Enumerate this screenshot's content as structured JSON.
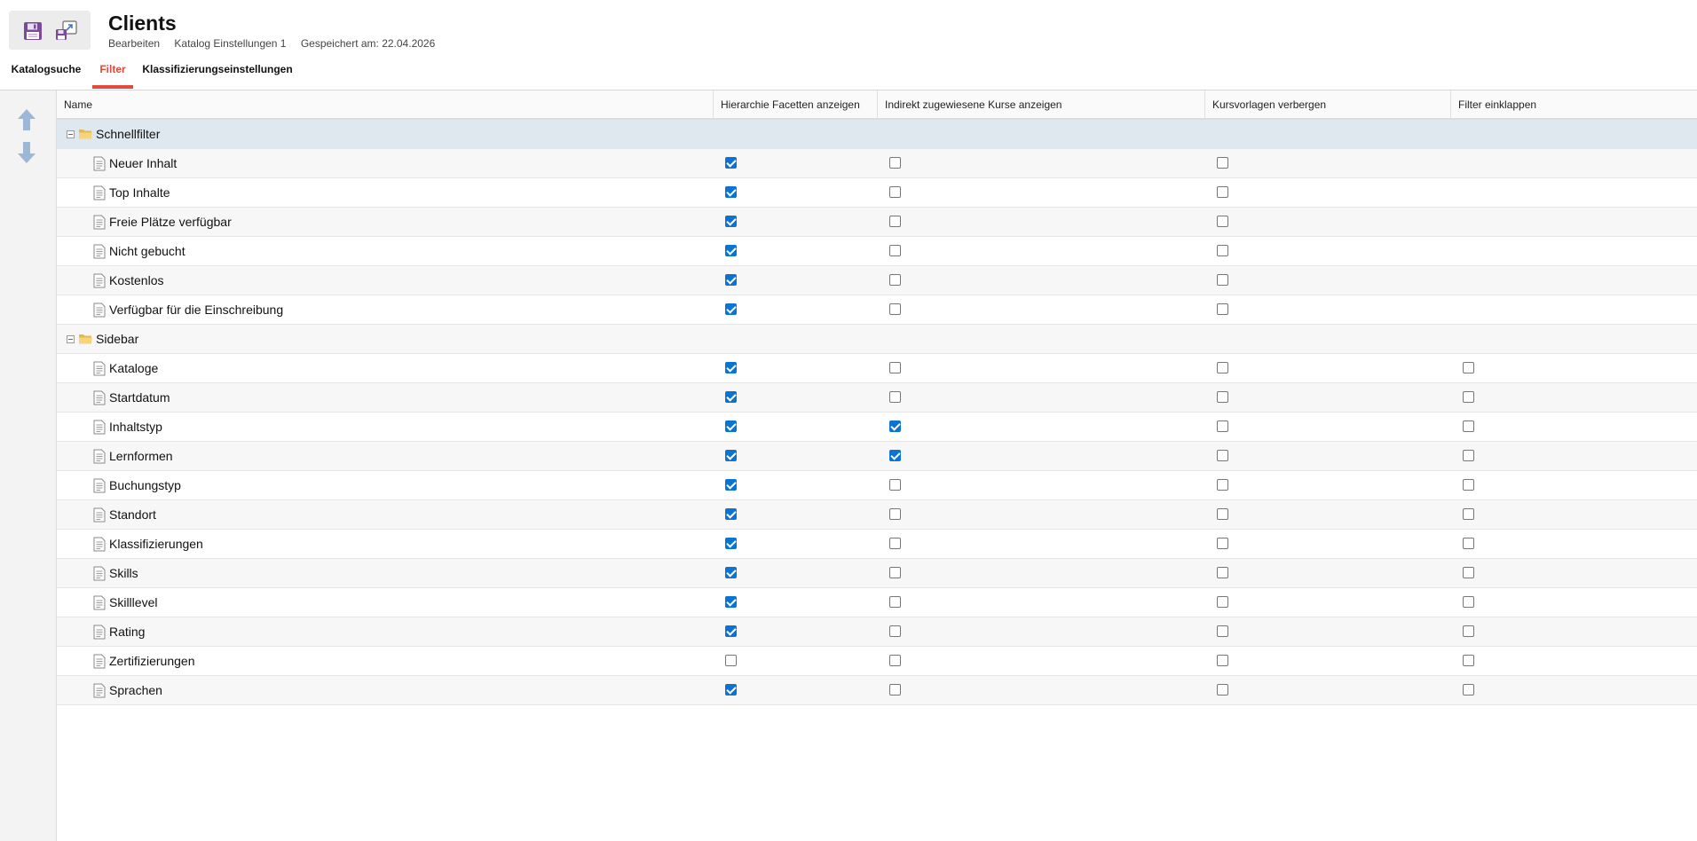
{
  "header": {
    "title": "Clients",
    "meta": [
      "Bearbeiten",
      "Katalog Einstellungen 1",
      "Gespeichert am: 22.04.2026"
    ]
  },
  "toolbar": {
    "save_icon": "floppy-disk-icon",
    "export_icon": "save-export-icon"
  },
  "tabs": [
    {
      "label": "Katalogsuche",
      "active": false
    },
    {
      "label": "Filter",
      "active": true
    },
    {
      "label": "Klassifizierungseinstellungen",
      "active": false
    }
  ],
  "rail": {
    "up_icon": "arrow-up-icon",
    "down_icon": "arrow-down-icon"
  },
  "columns": [
    "Name",
    "Hierarchie Facetten anzeigen",
    "Indirekt zugewiesene Kurse anzeigen",
    "Kursvorlagen verbergen",
    "Filter einklappen"
  ],
  "groups": [
    {
      "name": "Schnellfilter",
      "items": [
        {
          "name": "Neuer Inhalt",
          "values": [
            true,
            false,
            false,
            null
          ]
        },
        {
          "name": "Top Inhalte",
          "values": [
            true,
            false,
            false,
            null
          ]
        },
        {
          "name": "Freie Plätze verfügbar",
          "values": [
            true,
            false,
            false,
            null
          ]
        },
        {
          "name": "Nicht gebucht",
          "values": [
            true,
            false,
            false,
            null
          ]
        },
        {
          "name": "Kostenlos",
          "values": [
            true,
            false,
            false,
            null
          ]
        },
        {
          "name": "Verfügbar für die Einschreibung",
          "values": [
            true,
            false,
            false,
            null
          ]
        }
      ]
    },
    {
      "name": "Sidebar",
      "items": [
        {
          "name": "Kataloge",
          "values": [
            true,
            false,
            false,
            false
          ]
        },
        {
          "name": "Startdatum",
          "values": [
            true,
            false,
            false,
            false
          ]
        },
        {
          "name": "Inhaltstyp",
          "values": [
            true,
            true,
            false,
            false
          ]
        },
        {
          "name": "Lernformen",
          "values": [
            true,
            true,
            false,
            false
          ]
        },
        {
          "name": "Buchungstyp",
          "values": [
            true,
            false,
            false,
            false
          ]
        },
        {
          "name": "Standort",
          "values": [
            true,
            false,
            false,
            false
          ]
        },
        {
          "name": "Klassifizierungen",
          "values": [
            true,
            false,
            false,
            false
          ]
        },
        {
          "name": "Skills",
          "values": [
            true,
            false,
            false,
            false
          ]
        },
        {
          "name": "Skilllevel",
          "values": [
            true,
            false,
            false,
            false
          ]
        },
        {
          "name": "Rating",
          "values": [
            true,
            false,
            false,
            false
          ]
        },
        {
          "name": "Zertifizierungen",
          "values": [
            false,
            false,
            false,
            false
          ]
        },
        {
          "name": "Sprachen",
          "values": [
            true,
            false,
            false,
            false
          ]
        }
      ]
    }
  ],
  "colors": {
    "accent": "#e24a3b",
    "checkbox": "#0b73d1",
    "selected_row": "#dfe8ee",
    "arrow": "#9cb8d6"
  }
}
